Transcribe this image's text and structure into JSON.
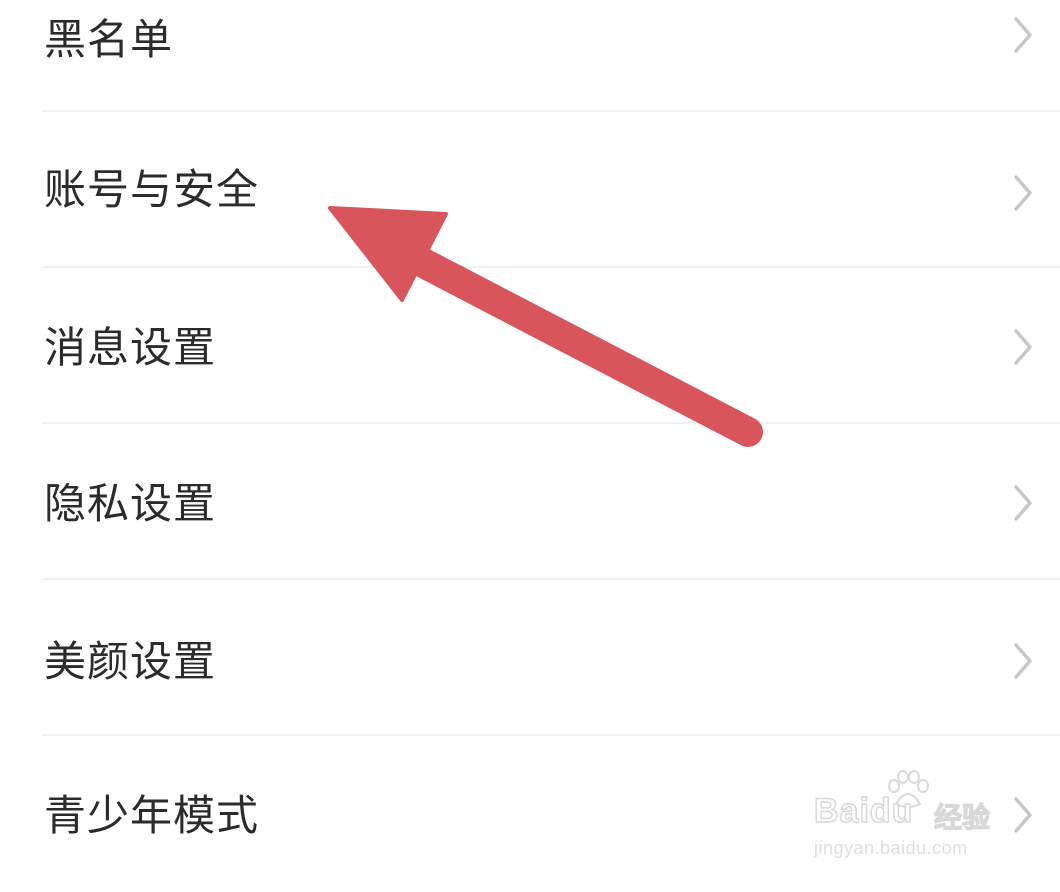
{
  "settings": {
    "items": [
      {
        "label": "黑名单"
      },
      {
        "label": "账号与安全"
      },
      {
        "label": "消息设置"
      },
      {
        "label": "隐私设置"
      },
      {
        "label": "美颜设置"
      },
      {
        "label": "青少年模式"
      }
    ]
  },
  "annotation": {
    "arrow_color": "#d9555c",
    "points_to": "账号与安全"
  },
  "watermark": {
    "brand": "Baidu",
    "suffix": "经验",
    "url": "jingyan.baidu.com"
  },
  "icons": {
    "row_chevron": "chevron-right-icon",
    "watermark_logo": "paw-icon"
  }
}
